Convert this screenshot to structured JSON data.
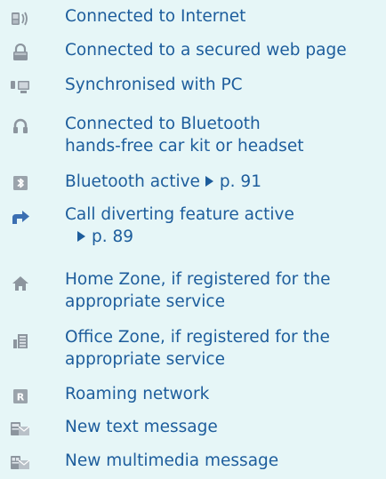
{
  "colors": {
    "background": "#e6f6f7",
    "text": "#1d5d9c",
    "icon_gray": "#8c959e",
    "icon_blue": "#3b6fb2"
  },
  "items": [
    {
      "icon": "phone-internet-icon",
      "lines": [
        "Connected to Internet"
      ]
    },
    {
      "icon": "padlock-icon",
      "lines": [
        "Connected to a secured web page"
      ]
    },
    {
      "icon": "pc-sync-icon",
      "lines": [
        "Synchronised with PC"
      ]
    },
    {
      "icon": "headset-icon",
      "lines": [
        "Connected to Bluetooth",
        "hands-free car kit or headset"
      ]
    },
    {
      "icon": "bluetooth-icon",
      "text": "Bluetooth active",
      "ref": "p. 91"
    },
    {
      "icon": "call-divert-icon",
      "text": "Call diverting feature active",
      "ref": "p. 89"
    },
    {
      "icon": "home-zone-icon",
      "lines": [
        "Home Zone, if registered for the",
        "appropriate service"
      ]
    },
    {
      "icon": "office-zone-icon",
      "lines": [
        "Office Zone, if registered for the",
        "appropriate service"
      ]
    },
    {
      "icon": "roaming-icon",
      "lines": [
        "Roaming network"
      ]
    },
    {
      "icon": "text-message-icon",
      "lines": [
        "New text message"
      ]
    },
    {
      "icon": "multimedia-message-icon",
      "lines": [
        "New multimedia message"
      ]
    }
  ]
}
